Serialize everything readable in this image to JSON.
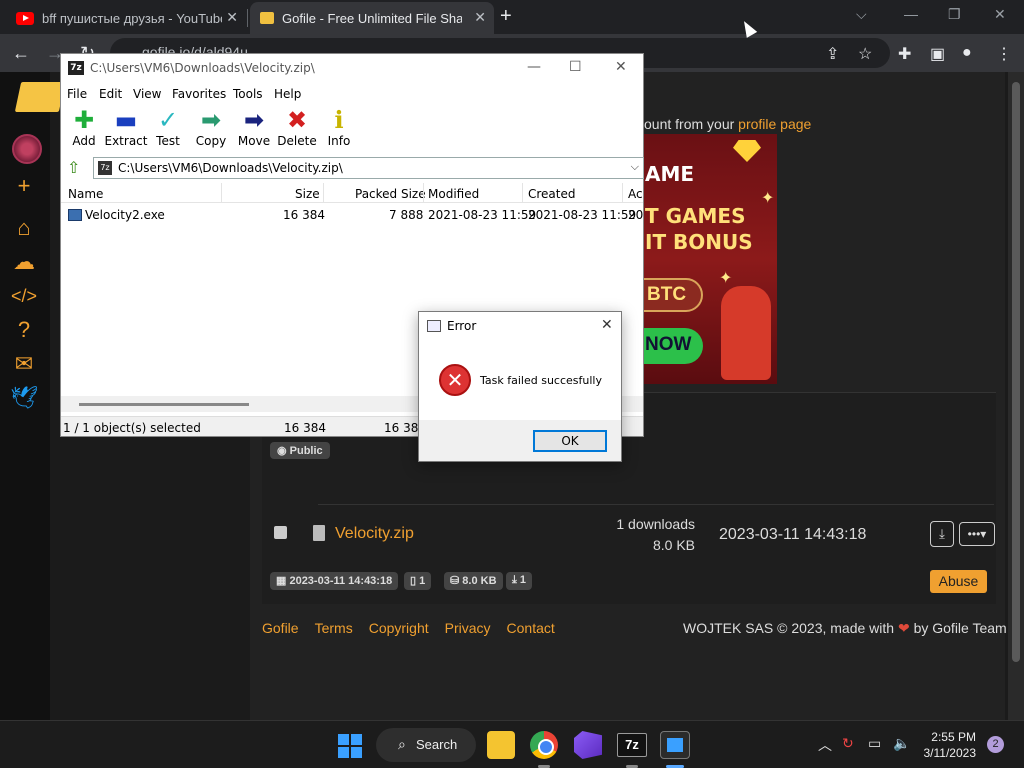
{
  "browser": {
    "tabs": [
      {
        "title": "bff пушистые друзья - YouTube",
        "icon": "youtube-icon"
      },
      {
        "title": "Gofile - Free Unlimited File Sharin",
        "icon": "gofile-icon"
      }
    ],
    "url": "gofile.io/d/ald94u"
  },
  "page": {
    "info_prefix": "ount from your ",
    "info_link": "profile page",
    "ad": {
      "line1": "AME",
      "line2": "T GAMES",
      "line3": "IT BONUS",
      "btc": "BTC",
      "now": "NOW"
    },
    "badge_public": "Public",
    "file": {
      "name": "Velocity.zip",
      "downloads": "1 downloads",
      "size": "8.0 KB",
      "date": "2023-03-11 14:43:18"
    },
    "meta": {
      "date": "2023-03-11 14:43:18",
      "files": "1",
      "size": "8.0 KB",
      "downloads": "1"
    },
    "abuse_label": "Abuse",
    "footer_links": [
      "Gofile",
      "Terms",
      "Copyright",
      "Privacy",
      "Contact"
    ],
    "copyright_prefix": "WOJTEK SAS © 2023, made with ",
    "copyright_suffix": " by Gofile Team"
  },
  "sevenzip": {
    "title": "C:\\Users\\VM6\\Downloads\\Velocity.zip\\",
    "menu": [
      "File",
      "Edit",
      "View",
      "Favorites",
      "Tools",
      "Help"
    ],
    "tools": [
      {
        "label": "Add",
        "icon": "add-icon",
        "color": "#1fae3a"
      },
      {
        "label": "Extract",
        "icon": "extract-icon",
        "color": "#1a3fbf"
      },
      {
        "label": "Test",
        "icon": "test-icon",
        "color": "#2ab8c0"
      },
      {
        "label": "Copy",
        "icon": "copy-icon",
        "color": "#2a9a70"
      },
      {
        "label": "Move",
        "icon": "move-icon",
        "color": "#1a237e"
      },
      {
        "label": "Delete",
        "icon": "delete-icon",
        "color": "#d32020"
      },
      {
        "label": "Info",
        "icon": "info-icon",
        "color": "#c8b400"
      }
    ],
    "path": "C:\\Users\\VM6\\Downloads\\Velocity.zip\\",
    "columns": [
      "Name",
      "Size",
      "Packed Size",
      "Modified",
      "Created",
      "Ac"
    ],
    "rows": [
      {
        "name": "Velocity2.exe",
        "size": "16 384",
        "packed": "7 888",
        "modified": "2021-08-23 11:59",
        "created": "2021-08-23 11:59",
        "accessed": "20"
      }
    ],
    "status": {
      "selected": "1 / 1 object(s) selected",
      "size1": "16 384",
      "size2": "16 384"
    }
  },
  "error_dialog": {
    "title": "Error",
    "message": "Task failed succesfully",
    "ok_label": "OK"
  },
  "taskbar": {
    "search_label": "Search",
    "time": "2:55 PM",
    "date": "3/11/2023",
    "notifications": "2"
  }
}
